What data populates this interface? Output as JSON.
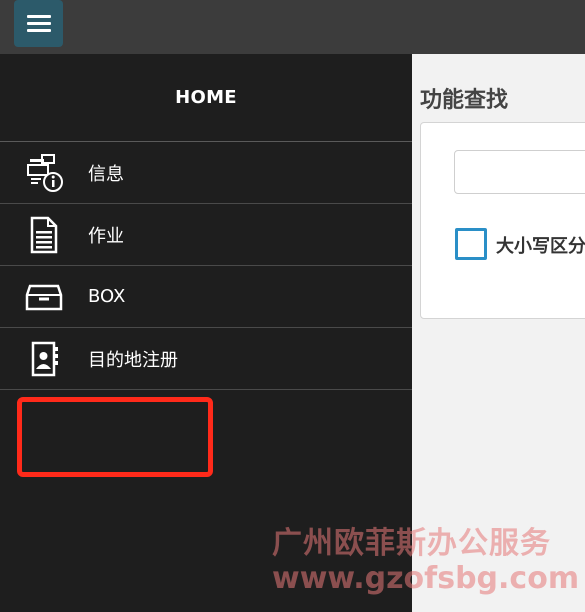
{
  "sidebar": {
    "header": "HOME",
    "items": [
      {
        "label": "信息",
        "icon": "fax-info-icon"
      },
      {
        "label": "作业",
        "icon": "document-icon"
      },
      {
        "label": "BOX",
        "icon": "box-tray-icon"
      },
      {
        "label": "目的地注册",
        "icon": "address-book-icon"
      }
    ]
  },
  "main": {
    "title": "功能查找",
    "search_value": "",
    "case_sensitive_label": "大小写区分"
  },
  "watermark": {
    "line1": "广州欧菲斯办公服务",
    "line2": "www.gzofsbg.com"
  },
  "colors": {
    "topbar": "#3c3c3c",
    "menu_button": "#2c5a6a",
    "sidebar": "#1e1e1e",
    "highlight": "#ff2a1a",
    "checkbox_border": "#2a8fc7"
  }
}
